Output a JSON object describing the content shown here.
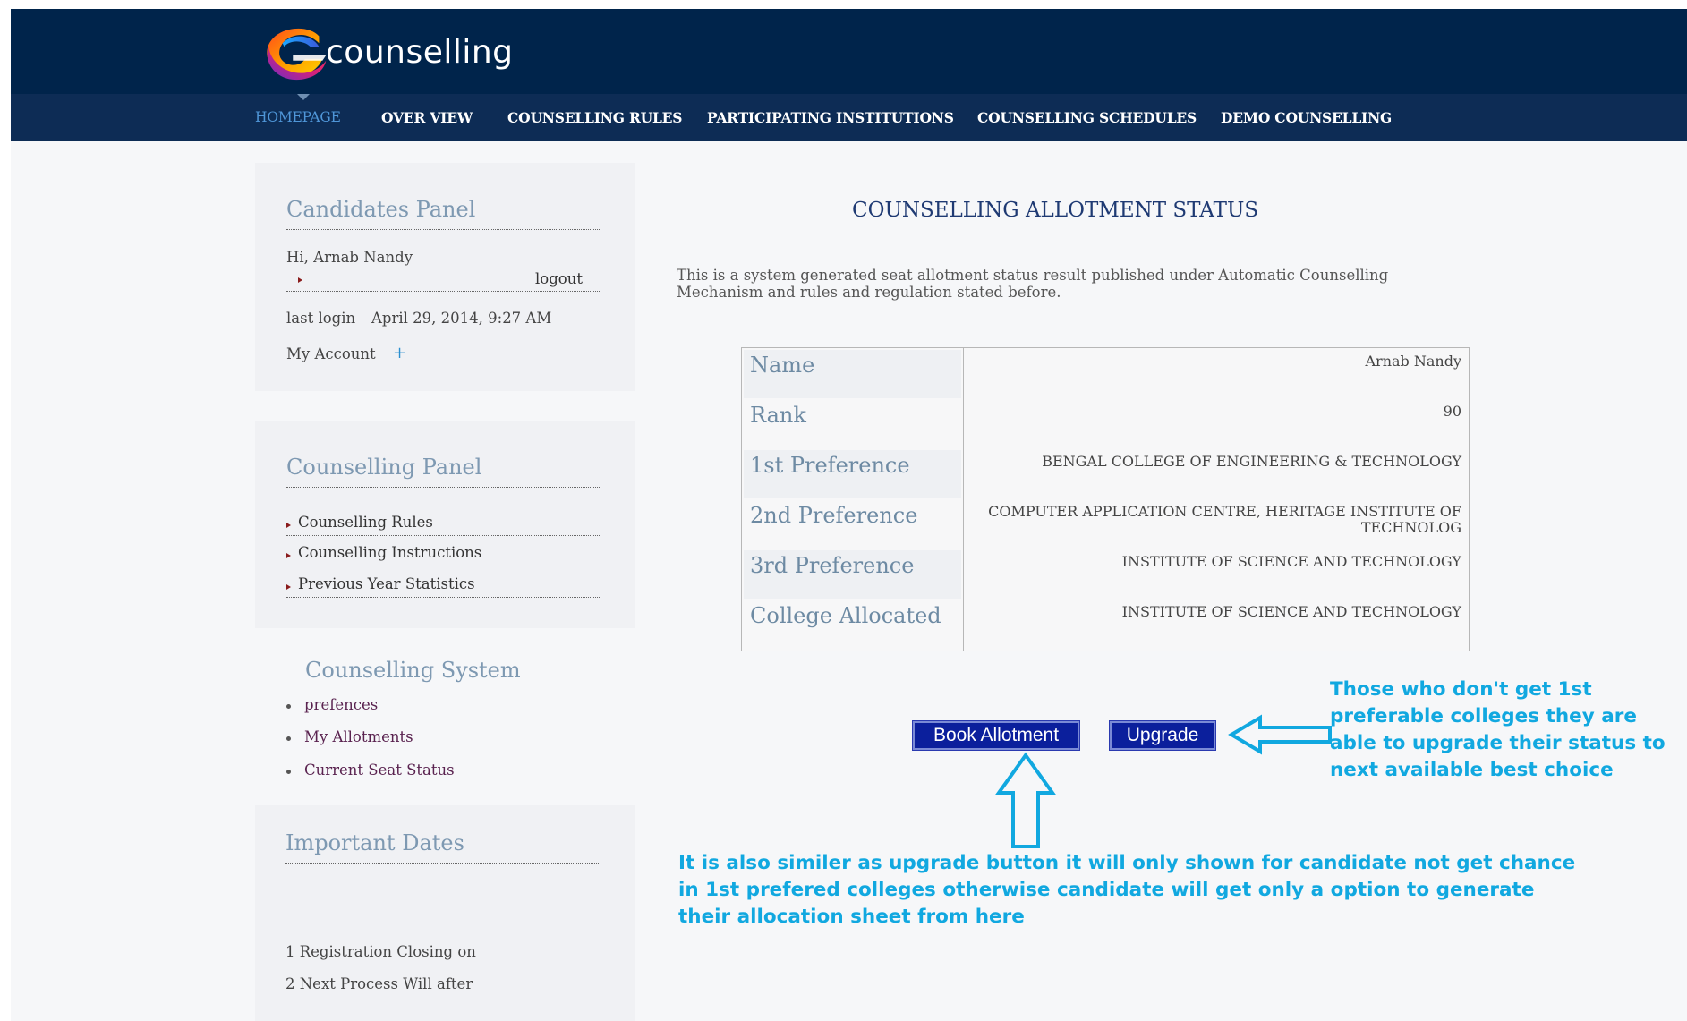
{
  "brand": {
    "logo_text": "counselling"
  },
  "nav": {
    "items": [
      {
        "label": "HOMEPAGE",
        "active": true
      },
      {
        "label": "OVER VIEW"
      },
      {
        "label": "COUNSELLING RULES"
      },
      {
        "label": "PARTICIPATING INSTITUTIONS"
      },
      {
        "label": "COUNSELLING SCHEDULES"
      },
      {
        "label": "DEMO COUNSELLING"
      }
    ]
  },
  "candidates_panel": {
    "title": "Candidates Panel",
    "greeting": "Hi,  Arnab Nandy",
    "logout": "logout",
    "last_login_label": "last login",
    "last_login_value": "April 29, 2014, 9:27 AM",
    "my_account": "My Account"
  },
  "counselling_panel": {
    "title": "Counselling Panel",
    "links": [
      "Counselling Rules",
      "Counselling Instructions",
      "Previous Year Statistics"
    ]
  },
  "counselling_system": {
    "title": "Counselling System",
    "links": [
      "prefences",
      "My Allotments",
      "Current Seat Status"
    ]
  },
  "important_dates": {
    "title": "Important Dates",
    "items": [
      "1 Registration Closing on",
      "2 Next Process Will after"
    ]
  },
  "main": {
    "title": "COUNSELLING ALLOTMENT STATUS",
    "intro": "This is a system generated seat allotment status result published under Automatic Counselling Mechanism and rules and regulation stated before.",
    "rows": [
      {
        "label": "Name",
        "value": "Arnab Nandy"
      },
      {
        "label": "Rank",
        "value": "90"
      },
      {
        "label": "1st Preference",
        "value": "BENGAL COLLEGE OF ENGINEERING & TECHNOLOGY"
      },
      {
        "label": "2nd Preference",
        "value": "COMPUTER APPLICATION CENTRE, HERITAGE INSTITUTE OF TECHNOLOG"
      },
      {
        "label": "3rd Preference",
        "value": "INSTITUTE OF SCIENCE AND TECHNOLOGY"
      },
      {
        "label": "College Allocated",
        "value": "INSTITUTE OF SCIENCE AND TECHNOLOGY"
      }
    ],
    "book_button": "Book Allotment",
    "upgrade_button": "Upgrade"
  },
  "annotations": {
    "upgrade_note": [
      "Those who don't get 1st",
      "preferable colleges they are",
      "able to upgrade their status to",
      "next available best choice"
    ],
    "book_note": [
      "It is also similer as  upgrade button it will only shown for candidate not get chance",
      "in 1st prefered colleges otherwise candidate will get only a option to generate",
      "their allocation sheet from here"
    ]
  },
  "colors": {
    "header_bg": "#00244b",
    "nav_bg": "#0d2c55",
    "nav_active": "#4f96d8",
    "button_bg": "#0b1f9c",
    "annotation": "#11a8e0"
  },
  "icons": [
    "logo-swirl-icon",
    "plus-icon",
    "arrow-left-icon",
    "arrow-up-icon"
  ]
}
